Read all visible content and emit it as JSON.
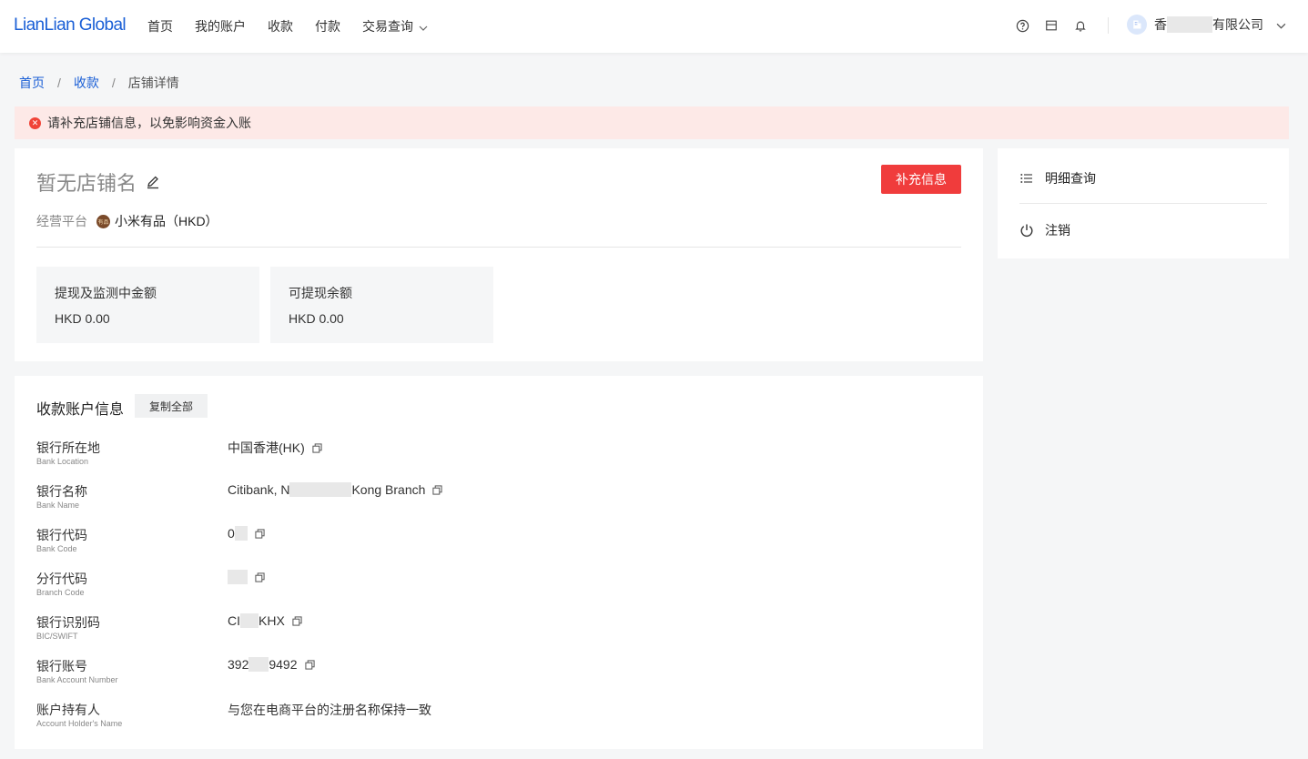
{
  "header": {
    "logo": "LianLian Global",
    "nav": [
      {
        "label": "首页"
      },
      {
        "label": "我的账户"
      },
      {
        "label": "收款"
      },
      {
        "label": "付款"
      },
      {
        "label": "交易查询"
      }
    ],
    "icons": [
      "help-icon",
      "calendar-icon",
      "bell-icon"
    ],
    "company_prefix": "香",
    "company_suffix": "有限公司"
  },
  "breadcrumb": {
    "home": "首页",
    "collect": "收款",
    "current": "店铺详情",
    "separator": "/"
  },
  "alert": {
    "text": "请补充店铺信息，以免影响资金入账",
    "color": "#f04438"
  },
  "store": {
    "name": "暂无店铺名",
    "supplement_button": "补充信息",
    "platform_label": "经营平台",
    "platform_logo_text": "有品",
    "platform_value": "小米有品（HKD）",
    "stats": [
      {
        "label": "提现及监测中金额",
        "value": "HKD 0.00"
      },
      {
        "label": "可提现余额",
        "value": "HKD 0.00"
      }
    ]
  },
  "side": {
    "details": "明细查询",
    "cancel": "注销"
  },
  "account": {
    "title": "收款账户信息",
    "copy_all": "复制全部",
    "rows": [
      {
        "label": "银行所在地",
        "sub": "Bank Location",
        "value": "中国香港(HK)"
      },
      {
        "label": "银行名称",
        "sub": "Bank Name",
        "value_a": "Citibank, N",
        "value_b": "Kong Branch"
      },
      {
        "label": "银行代码",
        "sub": "Bank Code",
        "value": "0"
      },
      {
        "label": "分行代码",
        "sub": "Branch Code",
        "value": ""
      },
      {
        "label": "银行识别码",
        "sub": "BIC/SWIFT",
        "value_a": "CI",
        "value_b": "KHX"
      },
      {
        "label": "银行账号",
        "sub": "Bank Account Number",
        "value_a": "392",
        "value_b": "9492"
      },
      {
        "label": "账户持有人",
        "sub": "Account Holder's Name",
        "value": "与您在电商平台的注册名称保持一致"
      }
    ]
  },
  "colors": {
    "brand": "#1a5fd6",
    "primary_button": "#f03c3c",
    "alert_bg": "#fde9e7"
  }
}
